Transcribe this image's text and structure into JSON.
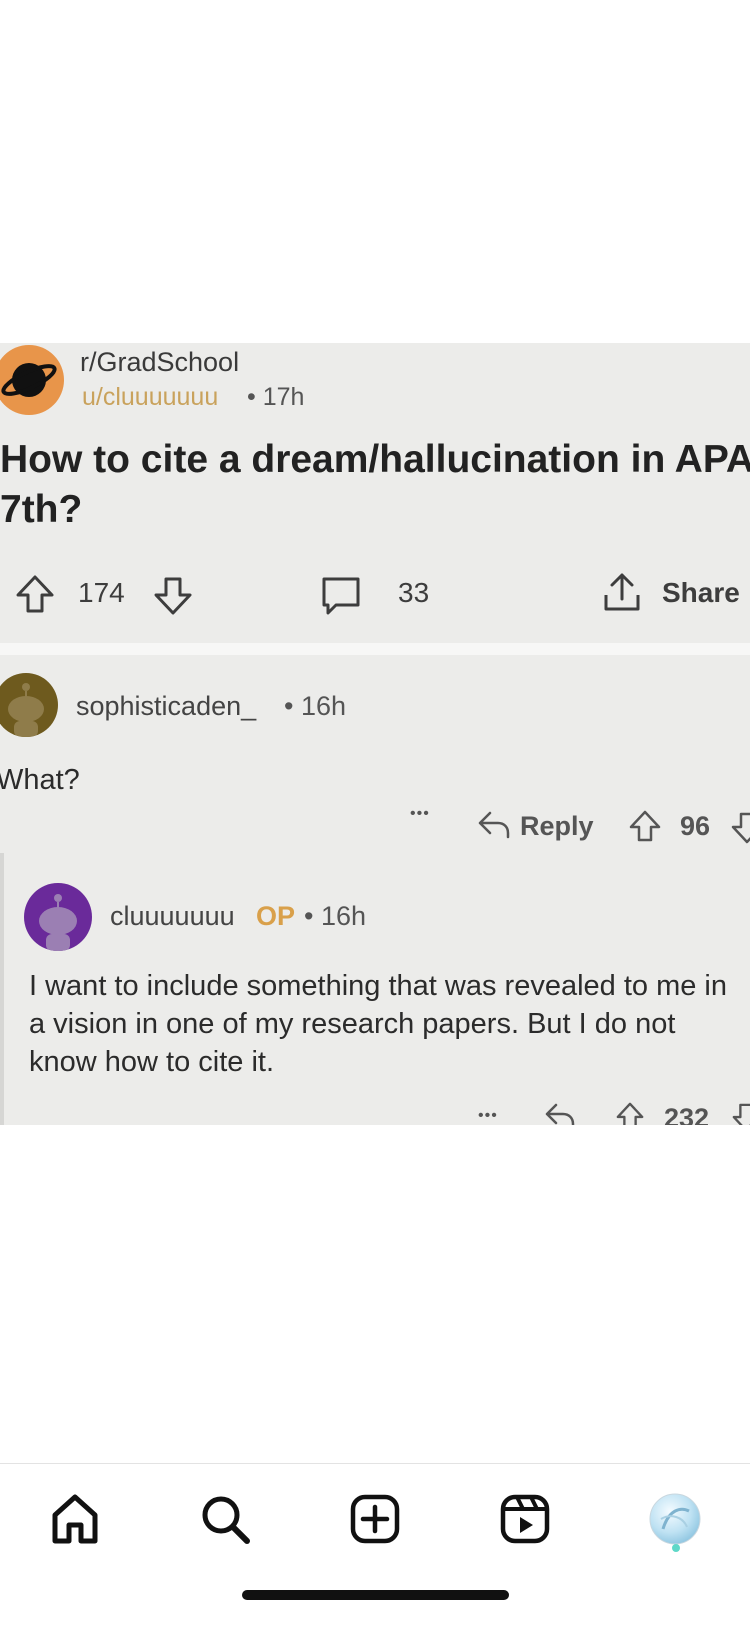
{
  "post": {
    "subreddit": "r/GradSchool",
    "author": "u/cluuuuuuu",
    "time": "• 17h",
    "title_line1": "How to cite a dream/hallucination in APA",
    "title_line2": "7th?",
    "upvotes": "174",
    "comments": "33",
    "share_label": "Share"
  },
  "comment1": {
    "author": "sophisticaden_",
    "time": "• 16h",
    "body": "What?",
    "more": "•••",
    "reply_label": "Reply",
    "votes": "96"
  },
  "comment2": {
    "author": "cluuuuuuu",
    "badge": "OP",
    "time": "• 16h",
    "body": "I want to include something that was revealed to me in a vision in one of my research papers. But I do not know how to cite it.",
    "more": "•••",
    "votes": "232"
  },
  "colors": {
    "post_bg": "#ececea",
    "subreddit_avatar": "#e8954a",
    "username": "#c9a25c",
    "op_badge": "#d9a04a",
    "commenter1_avatar": "#6e5a1e",
    "commenter2_avatar": "#6a2a9a"
  },
  "nav": {
    "items": [
      "home-icon",
      "search-icon",
      "create-icon",
      "reels-icon",
      "profile-icon"
    ]
  }
}
